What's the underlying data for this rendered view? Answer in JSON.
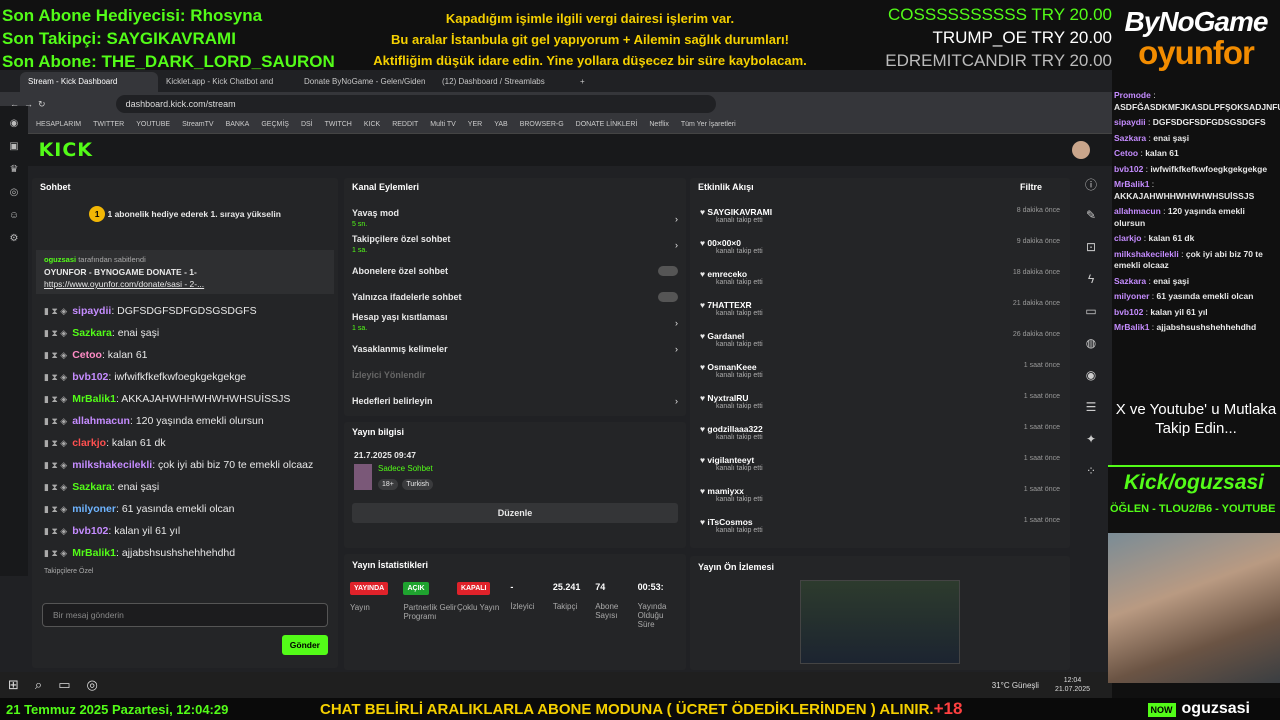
{
  "overlay_top_left": [
    {
      "text": "Son Abone Hediyecisi: Rhosyna",
      "color": "#53fc18"
    },
    {
      "text": "Son Takipçi: SAYGIKAVRAMI",
      "color": "#53fc18"
    },
    {
      "text": "Son Abone: THE_DARK_LORD_SAURON",
      "color": "#53fc18"
    }
  ],
  "overlay_message": [
    "Kapadığım işimle ilgili vergi dairesi işlerim var.",
    "Bu aralar İstanbula git gel yapıyorum + Ailemin sağlık durumları!",
    "Aktifliğim düşük idare edin. Yine yollara düşecez bir süre kaybolacam."
  ],
  "donations": [
    {
      "name": "COSSSSSSSSSS",
      "amount": "TRY 20.00",
      "color": "#53fc18"
    },
    {
      "name": "TRUMP_OE",
      "amount": "TRY 20.00",
      "color": "#ffffff"
    },
    {
      "name": "EDREMITCANDIR",
      "amount": "TRY 20.00",
      "color": "#bbbbbb"
    }
  ],
  "brand": {
    "line1": "ByNoGame",
    "line2": "oyunfor"
  },
  "browser": {
    "tabs": [
      "Stream - Kick Dashboard",
      "Kicklet.app - Kick Chatbot and",
      "Donate ByNoGame - Gelen/Giden",
      "(12) Dashboard / Streamlabs"
    ],
    "url": "dashboard.kick.com/stream",
    "bookmarks": [
      "HESAPLARIM",
      "TWITTER",
      "YOUTUBE",
      "StreamTV",
      "BANKA",
      "GEÇMİŞ",
      "DSİ",
      "TWITCH",
      "KICK",
      "REDDIT",
      "Multi TV",
      "YER",
      "YAB",
      "BROWSER-G",
      "DONATE LİNKLERİ",
      "Netflix",
      "Tüm Yer İşaretleri"
    ]
  },
  "kick": {
    "logo": "KICK"
  },
  "chat": {
    "title": "Sohbet",
    "sub_goal": "1 abonelik hediye ederek 1. sıraya yükselin",
    "sub_goal_num": "1",
    "pinned_by": "oguzsasi",
    "pinned_label": "tarafından sabitlendi",
    "pinned_text": "OYUNFOR - BYNOGAME DONATE - 1-",
    "pinned_link": "https://www.oyunfor.com/donate/sasi - 2-...",
    "messages": [
      {
        "user": "sipaydii",
        "color": "#c58cff",
        "text": "DGFSDGFSDFGDSGSDGFS"
      },
      {
        "user": "Sazkara",
        "color": "#53fc18",
        "text": "enai şaşi"
      },
      {
        "user": "Cetoo",
        "color": "#ff8cc6",
        "text": "kalan 61"
      },
      {
        "user": "bvb102",
        "color": "#c58cff",
        "text": "iwfwifkfkefkwfoegkgekgekge"
      },
      {
        "user": "MrBalik1",
        "color": "#53fc18",
        "text": "AKKAJAHWHHWHWHWHSUİSSJS"
      },
      {
        "user": "allahmacun",
        "color": "#c58cff",
        "text": "120 yaşında emekli olursun"
      },
      {
        "user": "clarkjo",
        "color": "#ff5050",
        "text": "kalan 61 dk"
      },
      {
        "user": "milkshakecilekli",
        "color": "#c58cff",
        "text": "çok iyi abi biz 70 te emekli olcaaz"
      },
      {
        "user": "Sazkara",
        "color": "#53fc18",
        "text": "enai şaşi"
      },
      {
        "user": "milyoner",
        "color": "#6eb4ff",
        "text": "61 yasında emekli olcan"
      },
      {
        "user": "bvb102",
        "color": "#c58cff",
        "text": "kalan yil 61 yıl"
      },
      {
        "user": "MrBalik1",
        "color": "#53fc18",
        "text": "ajjabshsushshehhehdhd"
      }
    ],
    "followers_only": "Takipçilere Özel",
    "placeholder": "Bir mesaj gönderin",
    "send": "Gönder"
  },
  "channel_actions": {
    "title": "Kanal Eylemleri",
    "items": [
      {
        "label": "Yavaş mod",
        "sub": "5 sn.",
        "control": "arrow"
      },
      {
        "label": "Takipçilere özel sohbet",
        "sub": "1 sa.",
        "control": "arrow"
      },
      {
        "label": "Abonelere özel sohbet",
        "sub": "",
        "control": "toggle"
      },
      {
        "label": "Yalnızca ifadelerle sohbet",
        "sub": "",
        "control": "toggle"
      },
      {
        "label": "Hesap yaşı kısıtlaması",
        "sub": "1 sa.",
        "control": "arrow"
      },
      {
        "label": "Yasaklanmış kelimeler",
        "sub": "",
        "control": "arrow"
      },
      {
        "label": "İzleyici Yönlendir",
        "sub": "",
        "control": "none"
      },
      {
        "label": "Hedefleri belirleyin",
        "sub": "",
        "control": "arrow"
      }
    ]
  },
  "stream_info": {
    "title": "Yayın bilgisi",
    "date": "21.7.2025 09:47",
    "category": "Sadece Sohbet",
    "tags": [
      "18+",
      "Turkish"
    ],
    "edit": "Düzenle"
  },
  "stream_stats": {
    "title": "Yayın İstatistikleri",
    "cols": [
      {
        "badge": "YAYINDA",
        "badge_color": "#e0222a",
        "label": "Yayın"
      },
      {
        "badge": "AÇIK",
        "badge_color": "#1fa32f",
        "label": "Partnerlik Gelir Programı"
      },
      {
        "badge": "KAPALI",
        "badge_color": "#e0222a",
        "label": "Çoklu Yayın"
      },
      {
        "value": "-",
        "label": "İzleyici"
      },
      {
        "value": "25.241",
        "label": "Takipçi"
      },
      {
        "value": "74",
        "label": "Abone Sayısı"
      },
      {
        "value": "00:53:",
        "label": "Yayında Olduğu Süre"
      }
    ]
  },
  "activity": {
    "title": "Etkinlik Akışı",
    "filter": "Filtre",
    "action": "kanalı takip etti",
    "items": [
      {
        "name": "SAYGIKAVRAMI",
        "time": "8 dakika önce"
      },
      {
        "name": "00×00×0",
        "time": "9 dakika önce"
      },
      {
        "name": "emreceko",
        "time": "18 dakika önce"
      },
      {
        "name": "7HATTEXR",
        "time": "21 dakika önce"
      },
      {
        "name": "Gardanel",
        "time": "26 dakika önce"
      },
      {
        "name": "OsmanKeee",
        "time": "1 saat önce"
      },
      {
        "name": "NyxtralRU",
        "time": "1 saat önce"
      },
      {
        "name": "godzillaaa322",
        "time": "1 saat önce"
      },
      {
        "name": "vigilanteeyt",
        "time": "1 saat önce"
      },
      {
        "name": "mamiyxx",
        "time": "1 saat önce"
      },
      {
        "name": "iTsCosmos",
        "time": "1 saat önce"
      }
    ]
  },
  "preview": {
    "title": "Yayın Ön İzlemesi"
  },
  "taskbar": {
    "weather": "31°C",
    "weather_label": "Güneşli",
    "time": "12:04",
    "date": "21.07.2025"
  },
  "overlay_chat": [
    {
      "user": "Promode",
      "text": "ASDFĞASDKMFJKASDLPFŞOKSADJNFUAKSLDŞFİ"
    },
    {
      "user": "sipaydii",
      "text": "DGFSDGFSDFGDSGSDGFS"
    },
    {
      "user": "Sazkara",
      "text": "enai şaşi"
    },
    {
      "user": "Cetoo",
      "text": "kalan 61"
    },
    {
      "user": "bvb102",
      "text": "iwfwifkfkefkwfoegkgekgekge"
    },
    {
      "user": "MrBalik1",
      "text": "AKKAJAHWHHWHWHWHSUİSSJS"
    },
    {
      "user": "allahmacun",
      "text": "120 yaşında emekli olursun"
    },
    {
      "user": "clarkjo",
      "text": "kalan 61 dk"
    },
    {
      "user": "milkshakecilekli",
      "text": "çok iyi abi biz 70 te emekli olcaaz"
    },
    {
      "user": "Sazkara",
      "text": "enai şaşi"
    },
    {
      "user": "milyoner",
      "text": "61 yasında emekli olcan"
    },
    {
      "user": "bvb102",
      "text": "kalan yil 61 yıl"
    },
    {
      "user": "MrBalik1",
      "text": "ajjabshsushshehhehdhd"
    }
  ],
  "follow_msg": "X ve Youtube' u Mutlaka Takip Edin...",
  "kick_banner": {
    "handle": "Kick/oguzsasi",
    "marquee": "ÖĞLEN - TLOU2/B6 - YOUTUBE"
  },
  "ticker": {
    "date": "21 Temmuz 2025 Pazartesi, 12:04:29",
    "text": "CHAT BELİRLİ ARALIKLARLA ABONE MODUNA ( ÜCRET ÖDEDİKLERİNDEN ) ALINIR.",
    "plus": "+18",
    "user": "oguzsasi",
    "logo": "NOW"
  }
}
